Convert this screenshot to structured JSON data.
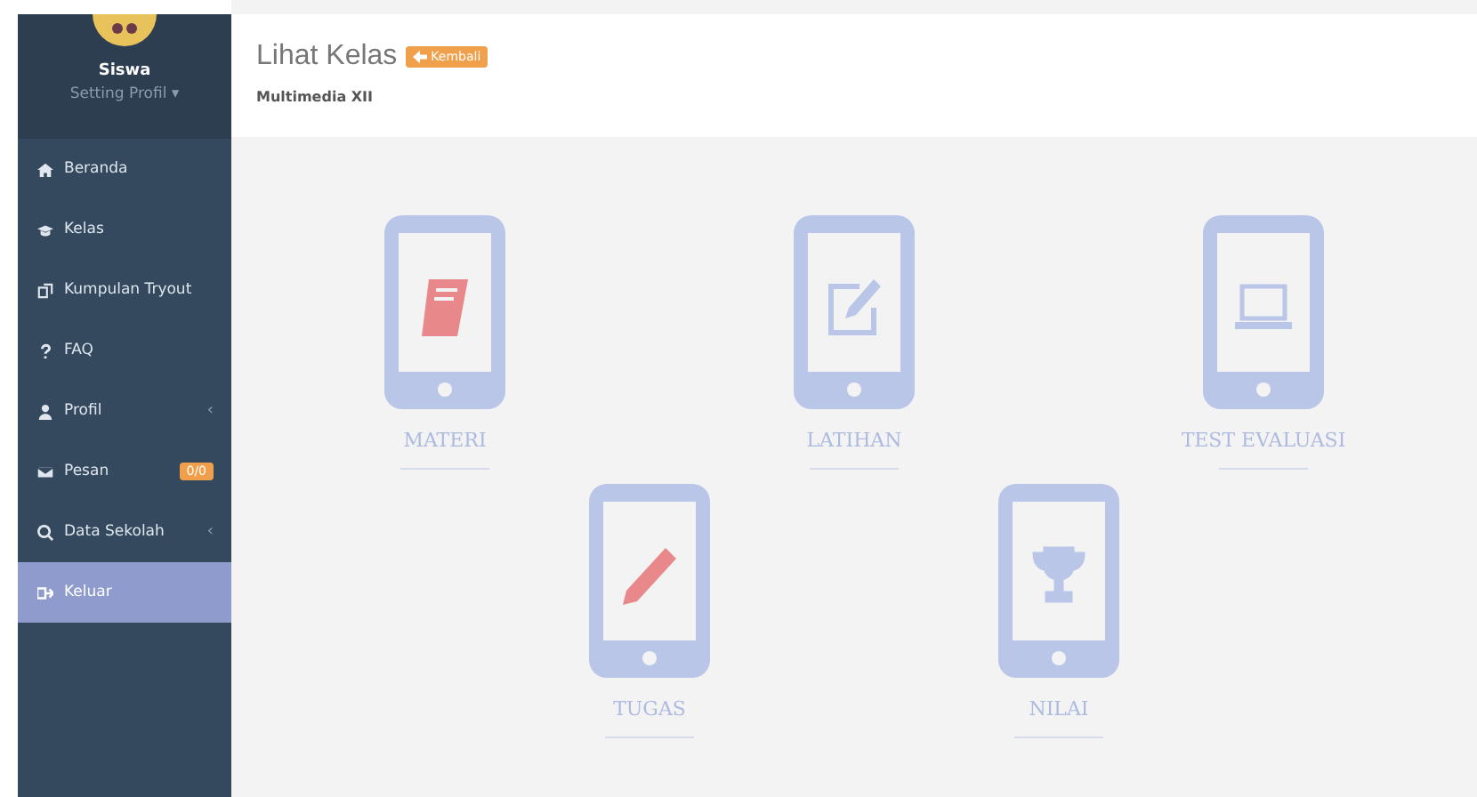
{
  "user": {
    "name": "Siswa",
    "settings_label": "Setting Profil ▾"
  },
  "menu": [
    {
      "kind": "home",
      "label": "Beranda",
      "selected": false
    },
    {
      "kind": "cap",
      "label": "Kelas",
      "selected": false
    },
    {
      "kind": "copy",
      "label": "Kumpulan Tryout",
      "selected": false
    },
    {
      "kind": "question",
      "label": "FAQ",
      "selected": false
    },
    {
      "kind": "user",
      "label": "Profil",
      "selected": false,
      "chevron": "‹"
    },
    {
      "kind": "mail",
      "label": "Pesan",
      "selected": false,
      "badge": "0/0"
    },
    {
      "kind": "search",
      "label": "Data Sekolah",
      "selected": false,
      "chevron": "‹"
    },
    {
      "kind": "exit",
      "label": "Keluar",
      "selected": true
    }
  ],
  "header": {
    "title": "Lihat Kelas",
    "back_button": "Kembali",
    "subtitle": "Multimedia XII"
  },
  "modules": [
    {
      "kind": "book",
      "label": "MATERI",
      "color": "#e8888a"
    },
    {
      "kind": "edit",
      "label": "LATIHAN",
      "color": "#b9c6e8"
    },
    {
      "kind": "laptop",
      "label": "TEST EVALUASI",
      "color": "#b9c6e8"
    },
    {
      "kind": "pencil",
      "label": "TUGAS",
      "color": "#e8888a"
    },
    {
      "kind": "trophy",
      "label": "NILAI",
      "color": "#b9c6e8"
    }
  ]
}
